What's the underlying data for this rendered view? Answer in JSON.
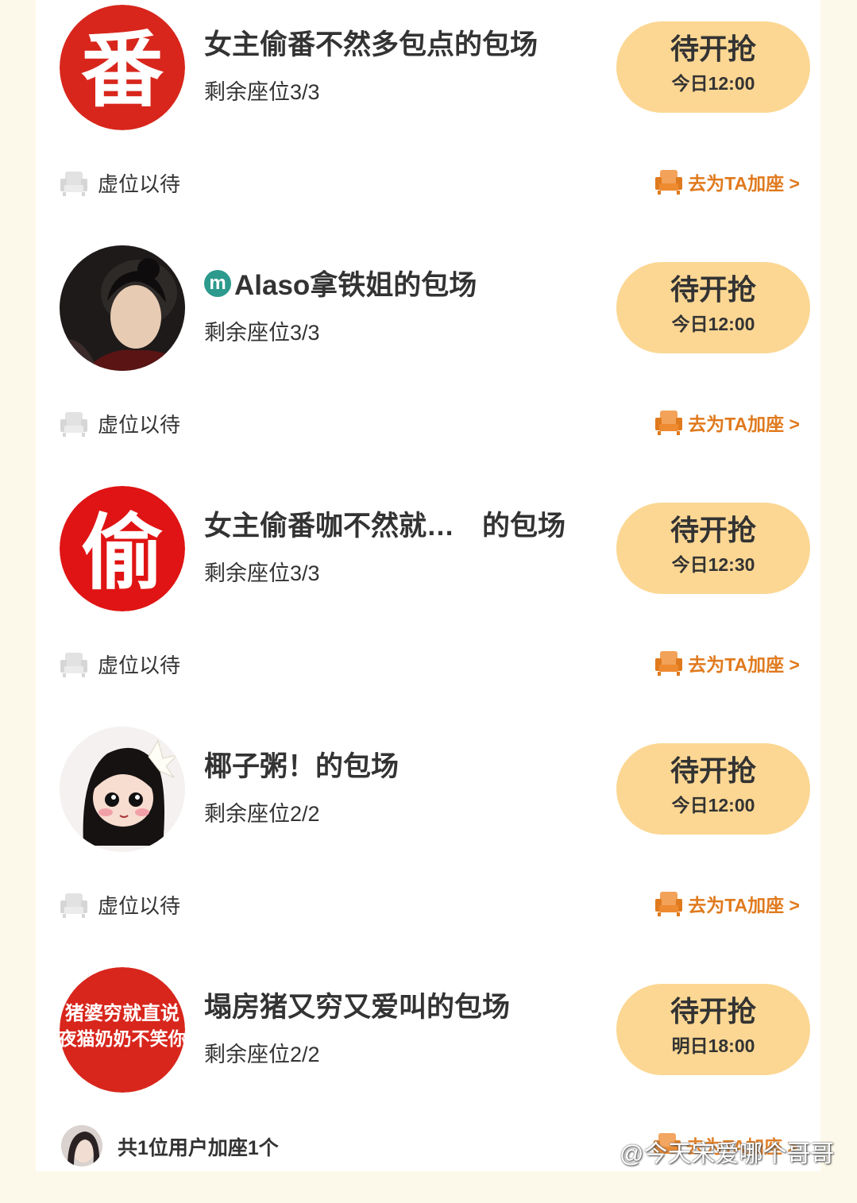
{
  "items": [
    {
      "title": "女主偷番不然多包点的包场",
      "seats": "剩余座位3/3",
      "button_label": "待开抢",
      "open_time": "今日12:00",
      "waiting_label": "虚位以待",
      "join_label": "去为TA加座 >",
      "avatar_text": "番"
    },
    {
      "title": "Alaso拿铁姐的包场",
      "title_badge": "m",
      "seats": "剩余座位3/3",
      "button_label": "待开抢",
      "open_time": "今日12:00",
      "waiting_label": "虚位以待",
      "join_label": "去为TA加座 >"
    },
    {
      "title": "女主偷番咖不然就…　的包场",
      "seats": "剩余座位3/3",
      "button_label": "待开抢",
      "open_time": "今日12:30",
      "waiting_label": "虚位以待",
      "join_label": "去为TA加座 >",
      "avatar_text": "偷"
    },
    {
      "title": "椰子粥！的包场",
      "seats": "剩余座位2/2",
      "button_label": "待开抢",
      "open_time": "今日12:00",
      "waiting_label": "虚位以待",
      "join_label": "去为TA加座 >"
    },
    {
      "title": "塌房猪又穷又爱叫的包场",
      "seats": "剩余座位2/2",
      "button_label": "待开抢",
      "open_time": "明日18:00",
      "avatar_text_line1": "猪婆穷就直说",
      "avatar_text_line2": "夜猫奶奶不笑你"
    }
  ],
  "footer": {
    "summary": "共1位用户加座1个",
    "join_label": "去为TA加座 >"
  },
  "watermark": "@今天宋爱哪个哥哥",
  "colors": {
    "button_bg": "#fcd793",
    "join_orange": "#e07a1e",
    "avatar_red": "#d8261c",
    "background": "#fdf9ea"
  }
}
